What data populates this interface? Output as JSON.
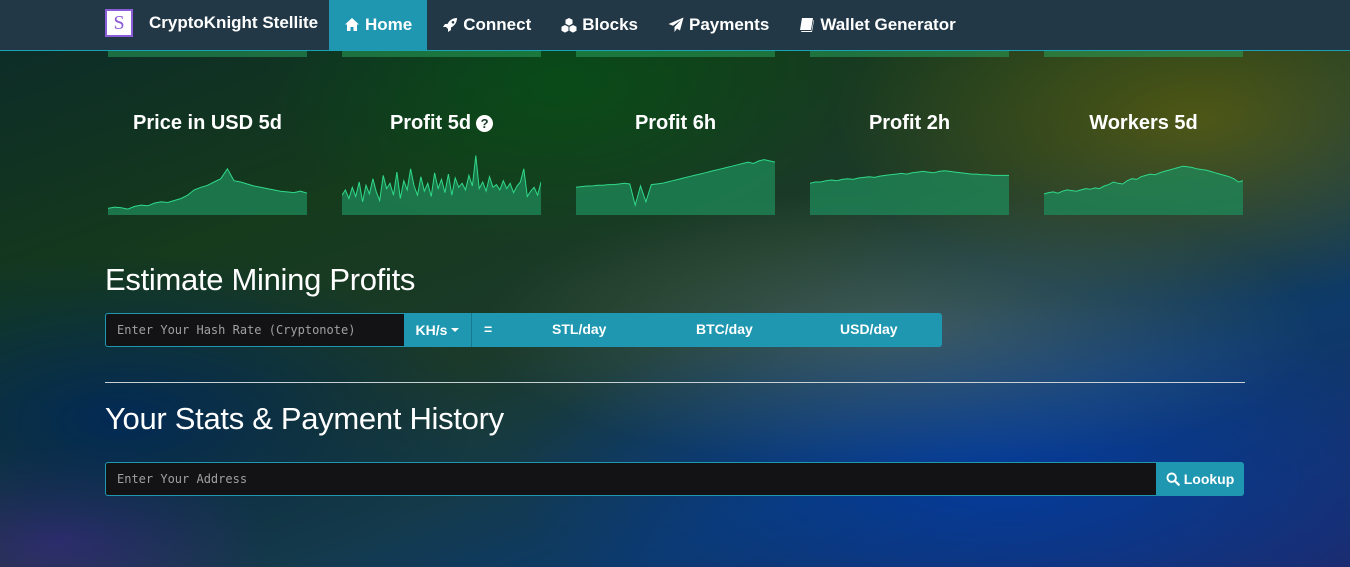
{
  "navbar": {
    "logo_letter": "S",
    "brand": "CryptoKnight Stellite",
    "items": [
      {
        "label": "Home",
        "icon": "home-icon",
        "active": true
      },
      {
        "label": "Connect",
        "icon": "rocket-icon",
        "active": false
      },
      {
        "label": "Blocks",
        "icon": "cubes-icon",
        "active": false
      },
      {
        "label": "Payments",
        "icon": "paper-plane-icon",
        "active": false
      },
      {
        "label": "Wallet Generator",
        "icon": "book-icon",
        "active": false
      }
    ]
  },
  "charts": [
    {
      "title": "Price in USD 5d",
      "help": false,
      "values": [
        10,
        12,
        11,
        9,
        13,
        15,
        14,
        18,
        20,
        19,
        22,
        25,
        30,
        38,
        42,
        45,
        50,
        55,
        70,
        52,
        50,
        47,
        44,
        42,
        40,
        38,
        36,
        35,
        34,
        36,
        33
      ]
    },
    {
      "title": "Profit 5d",
      "help": true,
      "help_glyph": "?",
      "values": [
        30,
        38,
        25,
        42,
        28,
        50,
        20,
        45,
        32,
        55,
        35,
        22,
        60,
        40,
        48,
        30,
        65,
        25,
        52,
        38,
        70,
        44,
        30,
        58,
        36,
        48,
        28,
        64,
        40,
        54,
        34,
        62,
        30,
        56,
        42,
        48,
        38,
        60,
        44,
        90,
        40,
        50,
        36,
        58,
        42,
        46,
        38,
        52,
        40,
        48,
        34,
        44,
        50,
        70,
        28,
        36,
        42,
        30,
        50
      ]
    },
    {
      "title": "Profit 6h",
      "help": false,
      "values": [
        42,
        43,
        44,
        44,
        45,
        45,
        46,
        46,
        47,
        48,
        47,
        15,
        44,
        20,
        46,
        47,
        48,
        50,
        52,
        54,
        56,
        58,
        60,
        62,
        64,
        66,
        68,
        70,
        72,
        74,
        76,
        78,
        80,
        78,
        82,
        84,
        82,
        80
      ]
    },
    {
      "title": "Profit 2h",
      "help": false,
      "values": [
        48,
        50,
        50,
        52,
        53,
        52,
        54,
        55,
        54,
        56,
        57,
        58,
        57,
        59,
        60,
        61,
        62,
        63,
        62,
        64,
        65,
        66,
        65,
        64,
        66,
        67,
        66,
        65,
        64,
        63,
        62,
        62,
        61,
        61,
        60,
        60,
        60,
        60
      ]
    },
    {
      "title": "Workers 5d",
      "help": false,
      "values": [
        32,
        34,
        35,
        33,
        36,
        38,
        37,
        36,
        38,
        40,
        39,
        41,
        40,
        44,
        46,
        50,
        48,
        47,
        52,
        55,
        54,
        58,
        60,
        62,
        61,
        64,
        66,
        68,
        70,
        72,
        74,
        73,
        72,
        70,
        69,
        68,
        66,
        64,
        62,
        60,
        58,
        55,
        50,
        52
      ]
    }
  ],
  "estimate": {
    "title": "Estimate Mining Profits",
    "placeholder": "Enter Your Hash Rate (Cryptonote)",
    "unit": "KH/s",
    "equals": "=",
    "stl": "STL/day",
    "btc": "BTC/day",
    "usd": "USD/day"
  },
  "stats": {
    "title": "Your Stats & Payment History",
    "placeholder": "Enter Your Address",
    "button": "Lookup"
  },
  "colors": {
    "accent": "#1f97b0",
    "navbar": "#223847",
    "chart_fill": "#1f8a5a",
    "chart_line": "#30d98a"
  }
}
